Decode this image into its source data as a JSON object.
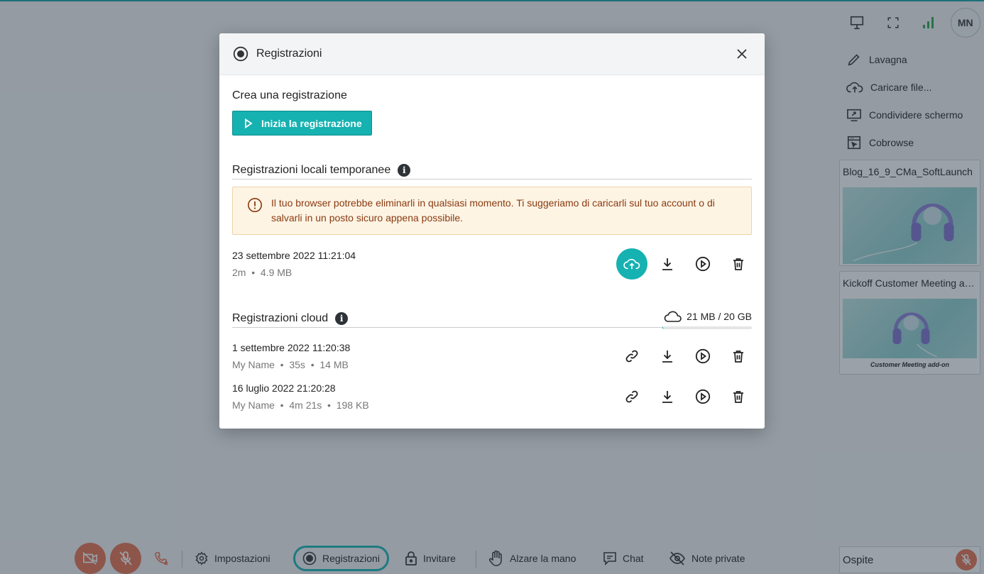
{
  "topbar": {
    "avatar_initials": "MN"
  },
  "side_menu": {
    "items": [
      {
        "label": "Lavagna",
        "icon": "pencil-icon"
      },
      {
        "label": "Caricare file...",
        "icon": "cloud-upload-icon"
      },
      {
        "label": "Condividere schermo",
        "icon": "screen-share-icon"
      },
      {
        "label": "Cobrowse",
        "icon": "cobrowse-icon"
      }
    ]
  },
  "thumbnails": [
    {
      "title": "Blog_16_9_CMa_SoftLaunch",
      "caption": ""
    },
    {
      "title": "Kickoff Customer Meeting add-on",
      "caption": "Customer Meeting add-on"
    }
  ],
  "bottom_bar": {
    "settings_label": "Impostazioni",
    "recordings_label": "Registrazioni",
    "invite_label": "Invitare",
    "raise_hand_label": "Alzare la mano",
    "chat_label": "Chat",
    "private_notes_label": "Note private"
  },
  "guest": {
    "name": "Ospite"
  },
  "modal": {
    "title": "Registrazioni",
    "create_heading": "Crea una registrazione",
    "start_button_label": "Inizia la registrazione",
    "local_section_title": "Registrazioni locali temporanee",
    "warning_text": "Il tuo browser potrebbe eliminarli in qualsiasi momento. Ti suggeriamo di caricarli sul tuo account o di salvarli in un posto sicuro appena possibile.",
    "local_recordings": [
      {
        "date": "23 settembre 2022 11:21:04",
        "meta": "2m  •  4.9 MB"
      }
    ],
    "cloud_section_title": "Registrazioni cloud",
    "cloud_quota": {
      "label": "21 MB / 20 GB",
      "used_fraction": 0.001
    },
    "cloud_recordings": [
      {
        "date": "1 settembre 2022 11:20:38",
        "meta": "My Name  •  35s  •  14 MB"
      },
      {
        "date": "16 luglio 2022 21:20:28",
        "meta": "My Name  •  4m 21s  •  198 KB"
      }
    ]
  },
  "colors": {
    "accent": "#16b1b1",
    "danger": "#e8704f",
    "warning_bg": "#fdf4e4",
    "warning_text": "#8a3a10"
  }
}
